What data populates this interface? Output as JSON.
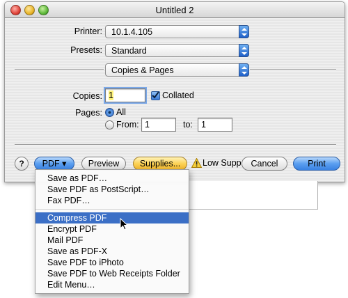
{
  "window": {
    "title": "Untitled 2"
  },
  "form": {
    "printer_label": "Printer:",
    "printer_value": "10.1.4.105",
    "presets_label": "Presets:",
    "presets_value": "Standard",
    "pane_value": "Copies & Pages",
    "copies_label": "Copies:",
    "copies_value": "1",
    "collated_label": "Collated",
    "collated_checked": true,
    "pages_label": "Pages:",
    "all_label": "All",
    "from_label": "From:",
    "from_value": "1",
    "to_label": "to:",
    "to_value": "1"
  },
  "buttons": {
    "help": "?",
    "pdf": "PDF ▾",
    "preview": "Preview",
    "supplies": "Supplies...",
    "low_supplies": "Low Suppl",
    "cancel": "Cancel",
    "print": "Print"
  },
  "pdf_menu": {
    "items": [
      "Save as PDF…",
      "Save PDF as PostScript…",
      "Fax PDF…",
      "Compress PDF",
      "Encrypt PDF",
      "Mail PDF",
      "Save as PDF-X",
      "Save PDF to iPhoto",
      "Save PDF to Web Receipts Folder",
      "Edit Menu…"
    ],
    "selected": "Compress PDF"
  },
  "icons": {
    "window_controls": [
      "close-icon",
      "minimize-icon",
      "zoom-icon"
    ],
    "warning": "warning-icon",
    "cursor": "pointer-cursor-icon",
    "popup_arrows": "up-down-arrows-icon"
  },
  "colors": {
    "accent_blue": "#3b6fc6",
    "supplies_yellow": "#f0b52a",
    "print_blue": "#5b9ff0"
  }
}
